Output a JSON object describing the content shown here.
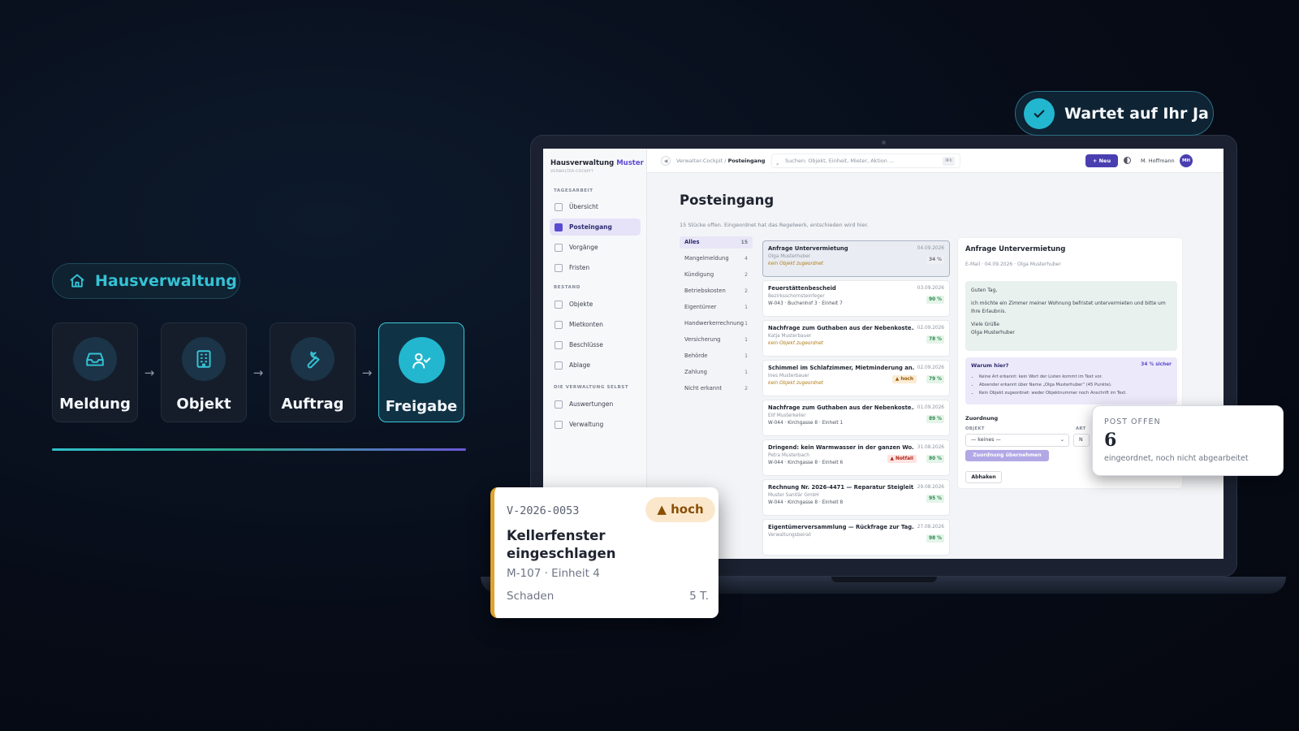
{
  "hero": {
    "brand_pill": "Hausverwaltung",
    "flow": [
      {
        "label": "Meldung",
        "icon": "inbox-icon"
      },
      {
        "label": "Objekt",
        "icon": "building-icon"
      },
      {
        "label": "Auftrag",
        "icon": "wrench-icon"
      },
      {
        "label": "Freigabe",
        "icon": "user-check-icon"
      }
    ],
    "arrow": "→"
  },
  "confirm_pill": {
    "label": "Wartet auf Ihr Ja",
    "icon": "check-icon"
  },
  "app": {
    "brand_name": "Hausverwaltung",
    "brand_accent": "Muster",
    "brand_sub": "VERWALTER-COCKPIT",
    "sections": {
      "tagesarbeit": "TAGESARBEIT",
      "bestand": "BESTAND",
      "verwaltung": "DIE VERWALTUNG SELBST"
    },
    "nav": [
      {
        "label": "Übersicht",
        "icon": "grid-icon"
      },
      {
        "label": "Posteingang",
        "icon": "inbox-icon",
        "active": true
      },
      {
        "label": "Vorgänge",
        "icon": "wrench-icon"
      },
      {
        "label": "Fristen",
        "icon": "calendar-icon"
      },
      {
        "label": "Objekte",
        "icon": "home-icon"
      },
      {
        "label": "Mietkonten",
        "icon": "wallet-icon"
      },
      {
        "label": "Beschlüsse",
        "icon": "document-icon"
      },
      {
        "label": "Ablage",
        "icon": "folder-icon"
      },
      {
        "label": "Auswertungen",
        "icon": "chart-icon"
      },
      {
        "label": "Verwaltung",
        "icon": "gear-icon"
      }
    ],
    "topbar": {
      "crumb_parent": "Verwalter-Cockpit",
      "crumb_sep": "/",
      "crumb_current": "Posteingang",
      "search_placeholder": "Suchen: Objekt, Einheit, Mieter, Aktion ...",
      "search_kbd": "⌘K",
      "new_button": "+ Neu",
      "user_name": "M. Hoffmann",
      "user_initials": "MH"
    },
    "page_title": "Posteingang",
    "page_sub": "15 Stücke offen. Eingeordnet hat das Regelwerk, entschieden wird hier.",
    "filters": [
      {
        "label": "Alles",
        "count": "15",
        "active": true
      },
      {
        "label": "Mangelmeldung",
        "count": "4"
      },
      {
        "label": "Kündigung",
        "count": "2"
      },
      {
        "label": "Betriebskosten",
        "count": "2"
      },
      {
        "label": "Eigentümer",
        "count": "1"
      },
      {
        "label": "Handwerkerrechnung",
        "count": "1"
      },
      {
        "label": "Versicherung",
        "count": "1"
      },
      {
        "label": "Behörde",
        "count": "1"
      },
      {
        "label": "Zahlung",
        "count": "1"
      },
      {
        "label": "Nicht erkannt",
        "count": "2"
      }
    ],
    "messages": [
      {
        "title": "Anfrage Untervermietung",
        "date": "04.09.2026",
        "sender": "Olga Musterhuber",
        "object": "kein Objekt zugeordnet",
        "pct": "34 %",
        "badge": "",
        "selected": true,
        "no_object": true
      },
      {
        "title": "Feuerstättenbescheid",
        "date": "03.09.2026",
        "sender": "Bezirksschornsteinfeger",
        "object": "W-043 · Buchenhof 3 · Einheit 7",
        "pct": "90 %",
        "badge": ""
      },
      {
        "title": "Nachfrage zum Guthaben aus der Nebenkoste...",
        "date": "02.09.2026",
        "sender": "Katja Musterbauer",
        "object": "kein Objekt zugeordnet",
        "pct": "78 %",
        "badge": "",
        "no_object": true
      },
      {
        "title": "Schimmel im Schlafzimmer, Mietminderung an...",
        "date": "02.09.2026",
        "sender": "Ines Musterbauer",
        "object": "kein Objekt zugeordnet",
        "pct": "79 %",
        "badge": "▲ hoch",
        "badge_kind": "hoch",
        "no_object": true
      },
      {
        "title": "Nachfrage zum Guthaben aus der Nebenkoste...",
        "date": "01.09.2026",
        "sender": "Elif Musterkeller",
        "object": "W-044 · Kirchgasse 8 · Einheit 1",
        "pct": "89 %",
        "badge": ""
      },
      {
        "title": "Dringend: kein Warmwasser in der ganzen Wo...",
        "date": "31.08.2026",
        "sender": "Petra Musterbach",
        "object": "W-044 · Kirchgasse 8 · Einheit 6",
        "pct": "80 %",
        "badge": "▲ Notfall",
        "badge_kind": "notfall"
      },
      {
        "title": "Rechnung Nr. 2026-4471 — Reparatur Steigleit...",
        "date": "29.08.2026",
        "sender": "Muster Sanitär GmbH",
        "object": "W-044 · Kirchgasse 8 · Einheit 8",
        "pct": "95 %",
        "badge": ""
      },
      {
        "title": "Eigentümerversammlung — Rückfrage zur Tag...",
        "date": "27.08.2026",
        "sender": "Verwaltungsbeirat",
        "object": "",
        "pct": "98 %",
        "badge": ""
      }
    ],
    "detail": {
      "title": "Anfrage Untervermietung",
      "meta": "E-Mail · 04.09.2026 · Olga Musterhuber",
      "mail_greeting": "Guten Tag,",
      "mail_body": "ich möchte ein Zimmer meiner Wohnung befristet untervermieten und bitte um Ihre Erlaubnis.",
      "mail_closing": "Viele Grüße",
      "mail_signature": "Olga Musterhuber",
      "why_title": "Warum hier?",
      "why_confidence": "34 % sicher",
      "why_reasons": [
        "Keine Art erkannt: kein Wort der Listen kommt im Text vor.",
        "Absender erkannt über Name „Olga Musterhuber“ (45 Punkte).",
        "Kein Objekt zugeordnet: weder Objektnummer noch Anschrift im Text."
      ],
      "assign_title": "Zuordnung",
      "object_label": "OBJEKT",
      "art_label": "ART",
      "object_value": "— keines —",
      "art_value": "N",
      "apply_button": "Zuordnung übernehmen",
      "done_button": "Abhaken"
    }
  },
  "stat_card": {
    "caption": "POST OFFEN",
    "value": "6",
    "description": "eingeordnet, noch nicht abgearbeitet"
  },
  "ticket_card": {
    "id": "V-2026-0053",
    "priority": "▲ hoch",
    "title": "Kellerfenster eingeschlagen",
    "location": "M-107 · Einheit 4",
    "category": "Schaden",
    "due": "5 T."
  },
  "colors": {
    "accent_cyan": "#22b7cf",
    "accent_purple": "#4a3fb0",
    "warning": "#e0a22e",
    "background": "#070c18"
  }
}
